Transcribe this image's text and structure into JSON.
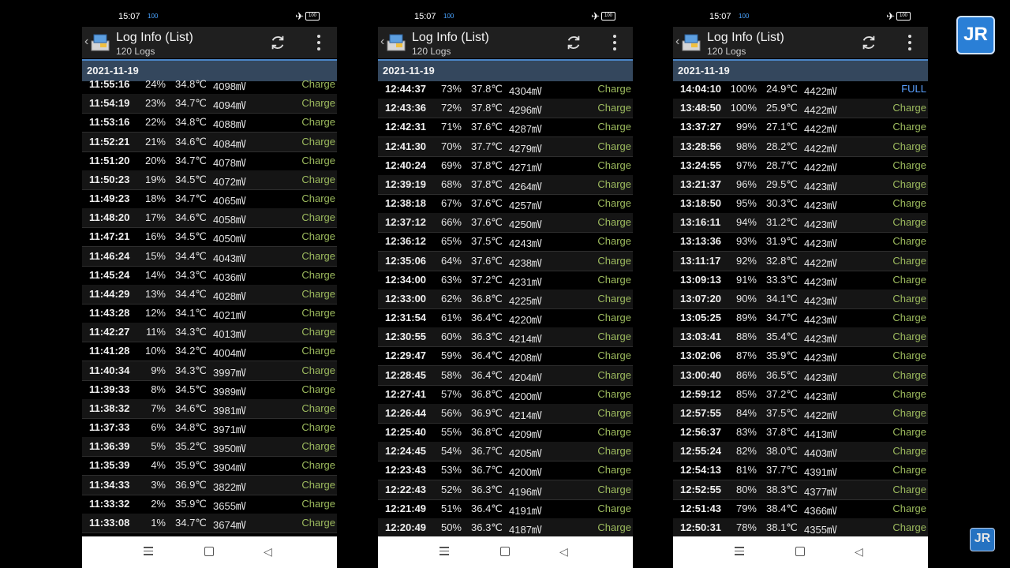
{
  "app": {
    "title": "Log Info (List)",
    "subtitle": "120 Logs",
    "date": "2021-11-19",
    "status_time": "15:07",
    "status_mini": "100",
    "battery": "100"
  },
  "panels": [
    {
      "rows": [
        [
          "11:55:16",
          "24%",
          "34.8℃",
          "4098㎷",
          "Charge"
        ],
        [
          "11:54:19",
          "23%",
          "34.7℃",
          "4094㎷",
          "Charge"
        ],
        [
          "11:53:16",
          "22%",
          "34.8℃",
          "4088㎷",
          "Charge"
        ],
        [
          "11:52:21",
          "21%",
          "34.6℃",
          "4084㎷",
          "Charge"
        ],
        [
          "11:51:20",
          "20%",
          "34.7℃",
          "4078㎷",
          "Charge"
        ],
        [
          "11:50:23",
          "19%",
          "34.5℃",
          "4072㎷",
          "Charge"
        ],
        [
          "11:49:23",
          "18%",
          "34.7℃",
          "4065㎷",
          "Charge"
        ],
        [
          "11:48:20",
          "17%",
          "34.6℃",
          "4058㎷",
          "Charge"
        ],
        [
          "11:47:21",
          "16%",
          "34.5℃",
          "4050㎷",
          "Charge"
        ],
        [
          "11:46:24",
          "15%",
          "34.4℃",
          "4043㎷",
          "Charge"
        ],
        [
          "11:45:24",
          "14%",
          "34.3℃",
          "4036㎷",
          "Charge"
        ],
        [
          "11:44:29",
          "13%",
          "34.4℃",
          "4028㎷",
          "Charge"
        ],
        [
          "11:43:28",
          "12%",
          "34.1℃",
          "4021㎷",
          "Charge"
        ],
        [
          "11:42:27",
          "11%",
          "34.3℃",
          "4013㎷",
          "Charge"
        ],
        [
          "11:41:28",
          "10%",
          "34.2℃",
          "4004㎷",
          "Charge"
        ],
        [
          "11:40:34",
          "9%",
          "34.3℃",
          "3997㎷",
          "Charge"
        ],
        [
          "11:39:33",
          "8%",
          "34.5℃",
          "3989㎷",
          "Charge"
        ],
        [
          "11:38:32",
          "7%",
          "34.6℃",
          "3981㎷",
          "Charge"
        ],
        [
          "11:37:33",
          "6%",
          "34.8℃",
          "3971㎷",
          "Charge"
        ],
        [
          "11:36:39",
          "5%",
          "35.2℃",
          "3950㎷",
          "Charge"
        ],
        [
          "11:35:39",
          "4%",
          "35.9℃",
          "3904㎷",
          "Charge"
        ],
        [
          "11:34:33",
          "3%",
          "36.9℃",
          "3822㎷",
          "Charge"
        ],
        [
          "11:33:32",
          "2%",
          "35.9℃",
          "3655㎷",
          "Charge"
        ],
        [
          "11:33:08",
          "1%",
          "34.7℃",
          "3674㎷",
          "Charge"
        ]
      ]
    },
    {
      "rows": [
        [
          "12:44:37",
          "73%",
          "37.8℃",
          "4304㎷",
          "Charge"
        ],
        [
          "12:43:36",
          "72%",
          "37.8℃",
          "4296㎷",
          "Charge"
        ],
        [
          "12:42:31",
          "71%",
          "37.6℃",
          "4287㎷",
          "Charge"
        ],
        [
          "12:41:30",
          "70%",
          "37.7℃",
          "4279㎷",
          "Charge"
        ],
        [
          "12:40:24",
          "69%",
          "37.8℃",
          "4271㎷",
          "Charge"
        ],
        [
          "12:39:19",
          "68%",
          "37.8℃",
          "4264㎷",
          "Charge"
        ],
        [
          "12:38:18",
          "67%",
          "37.6℃",
          "4257㎷",
          "Charge"
        ],
        [
          "12:37:12",
          "66%",
          "37.6℃",
          "4250㎷",
          "Charge"
        ],
        [
          "12:36:12",
          "65%",
          "37.5℃",
          "4243㎷",
          "Charge"
        ],
        [
          "12:35:06",
          "64%",
          "37.6℃",
          "4238㎷",
          "Charge"
        ],
        [
          "12:34:00",
          "63%",
          "37.2℃",
          "4231㎷",
          "Charge"
        ],
        [
          "12:33:00",
          "62%",
          "36.8℃",
          "4225㎷",
          "Charge"
        ],
        [
          "12:31:54",
          "61%",
          "36.4℃",
          "4220㎷",
          "Charge"
        ],
        [
          "12:30:55",
          "60%",
          "36.3℃",
          "4214㎷",
          "Charge"
        ],
        [
          "12:29:47",
          "59%",
          "36.4℃",
          "4208㎷",
          "Charge"
        ],
        [
          "12:28:45",
          "58%",
          "36.4℃",
          "4204㎷",
          "Charge"
        ],
        [
          "12:27:41",
          "57%",
          "36.8℃",
          "4200㎷",
          "Charge"
        ],
        [
          "12:26:44",
          "56%",
          "36.9℃",
          "4214㎷",
          "Charge"
        ],
        [
          "12:25:40",
          "55%",
          "36.8℃",
          "4209㎷",
          "Charge"
        ],
        [
          "12:24:45",
          "54%",
          "36.7℃",
          "4205㎷",
          "Charge"
        ],
        [
          "12:23:43",
          "53%",
          "36.7℃",
          "4200㎷",
          "Charge"
        ],
        [
          "12:22:43",
          "52%",
          "36.3℃",
          "4196㎷",
          "Charge"
        ],
        [
          "12:21:49",
          "51%",
          "36.4℃",
          "4191㎷",
          "Charge"
        ],
        [
          "12:20:49",
          "50%",
          "36.3℃",
          "4187㎷",
          "Charge"
        ]
      ]
    },
    {
      "rows": [
        [
          "14:04:10",
          "100%",
          "24.9℃",
          "4422㎷",
          "FULL"
        ],
        [
          "13:48:50",
          "100%",
          "25.9℃",
          "4422㎷",
          "Charge"
        ],
        [
          "13:37:27",
          "99%",
          "27.1℃",
          "4422㎷",
          "Charge"
        ],
        [
          "13:28:56",
          "98%",
          "28.2℃",
          "4422㎷",
          "Charge"
        ],
        [
          "13:24:55",
          "97%",
          "28.7℃",
          "4422㎷",
          "Charge"
        ],
        [
          "13:21:37",
          "96%",
          "29.5℃",
          "4423㎷",
          "Charge"
        ],
        [
          "13:18:50",
          "95%",
          "30.3℃",
          "4423㎷",
          "Charge"
        ],
        [
          "13:16:11",
          "94%",
          "31.2℃",
          "4423㎷",
          "Charge"
        ],
        [
          "13:13:36",
          "93%",
          "31.9℃",
          "4423㎷",
          "Charge"
        ],
        [
          "13:11:17",
          "92%",
          "32.8℃",
          "4422㎷",
          "Charge"
        ],
        [
          "13:09:13",
          "91%",
          "33.3℃",
          "4423㎷",
          "Charge"
        ],
        [
          "13:07:20",
          "90%",
          "34.1℃",
          "4423㎷",
          "Charge"
        ],
        [
          "13:05:25",
          "89%",
          "34.7℃",
          "4423㎷",
          "Charge"
        ],
        [
          "13:03:41",
          "88%",
          "35.4℃",
          "4423㎷",
          "Charge"
        ],
        [
          "13:02:06",
          "87%",
          "35.9℃",
          "4423㎷",
          "Charge"
        ],
        [
          "13:00:40",
          "86%",
          "36.5℃",
          "4423㎷",
          "Charge"
        ],
        [
          "12:59:12",
          "85%",
          "37.2℃",
          "4423㎷",
          "Charge"
        ],
        [
          "12:57:55",
          "84%",
          "37.5℃",
          "4422㎷",
          "Charge"
        ],
        [
          "12:56:37",
          "83%",
          "37.8℃",
          "4413㎷",
          "Charge"
        ],
        [
          "12:55:24",
          "82%",
          "38.0℃",
          "4403㎷",
          "Charge"
        ],
        [
          "12:54:13",
          "81%",
          "37.7℃",
          "4391㎷",
          "Charge"
        ],
        [
          "12:52:55",
          "80%",
          "38.3℃",
          "4377㎷",
          "Charge"
        ],
        [
          "12:51:43",
          "79%",
          "38.4℃",
          "4366㎷",
          "Charge"
        ],
        [
          "12:50:31",
          "78%",
          "38.1℃",
          "4355㎷",
          "Charge"
        ]
      ]
    }
  ],
  "watermark": "JR",
  "colors": {
    "charge": "#9dbb5e",
    "full": "#5aa0ff",
    "date_bar": "#34475d"
  }
}
